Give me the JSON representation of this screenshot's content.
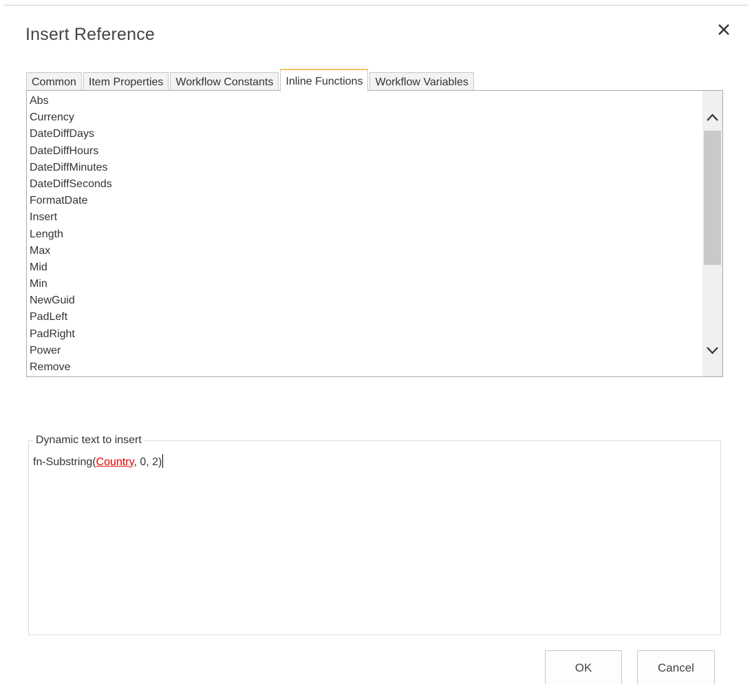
{
  "dialog": {
    "title": "Insert Reference",
    "close_icon": "close-icon"
  },
  "tabs": [
    {
      "label": "Common",
      "active": false
    },
    {
      "label": "Item Properties",
      "active": false
    },
    {
      "label": "Workflow Constants",
      "active": false
    },
    {
      "label": "Inline Functions",
      "active": true
    },
    {
      "label": "Workflow Variables",
      "active": false
    }
  ],
  "functions": [
    "Abs",
    "Currency",
    "DateDiffDays",
    "DateDiffHours",
    "DateDiffMinutes",
    "DateDiffSeconds",
    "FormatDate",
    "Insert",
    "Length",
    "Max",
    "Mid",
    "Min",
    "NewGuid",
    "PadLeft",
    "PadRight",
    "Power",
    "Remove"
  ],
  "scroll_icons": {
    "up": "chevron-up-icon",
    "down": "chevron-down-icon"
  },
  "dynamic_text": {
    "legend": "Dynamic text to insert",
    "prefix": "fn-Substring(",
    "reference": "Country",
    "suffix": ", 0, 2)"
  },
  "buttons": {
    "ok_label": "OK",
    "cancel_label": "Cancel"
  },
  "colors": {
    "active_tab_accent": "#f5c16a",
    "reference_token": "#e00000"
  }
}
